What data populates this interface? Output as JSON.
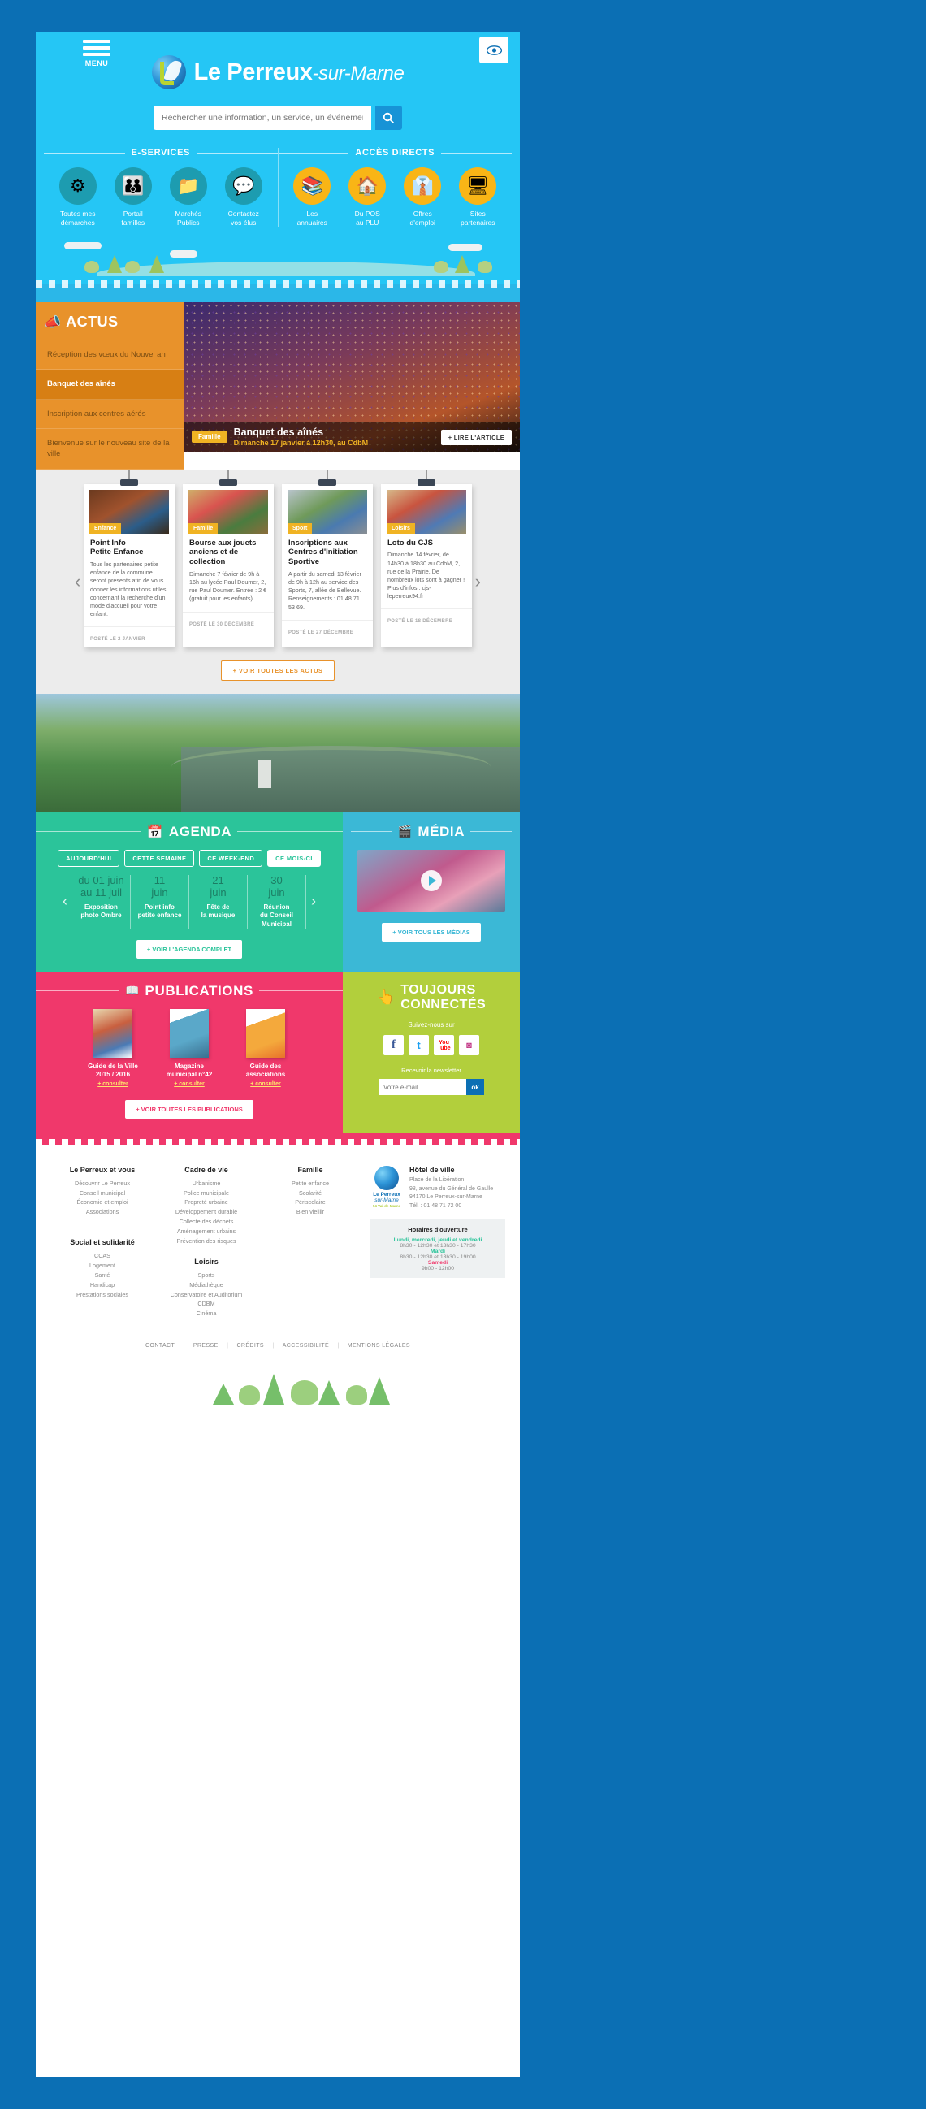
{
  "header": {
    "menu_label": "MENU",
    "accessibility_icon": "eye-icon",
    "brand_main": "Le Perreux",
    "brand_suffix": "-sur-Marne",
    "search_placeholder": "Rechercher une information, un service, un événement...",
    "search_value": "",
    "search_icon": "search-icon"
  },
  "eservices": {
    "title": "E-SERVICES",
    "items": [
      {
        "label_1": "Toutes mes",
        "label_2": "démarches",
        "icon": "gears-icon"
      },
      {
        "label_1": "Portail",
        "label_2": "familles",
        "icon": "family-icon"
      },
      {
        "label_1": "Marchés",
        "label_2": "Publics",
        "icon": "folder-icon"
      },
      {
        "label_1": "Contactez",
        "label_2": "vos élus",
        "icon": "speech-bubbles-icon"
      }
    ]
  },
  "acces_directs": {
    "title": "ACCÈS DIRECTS",
    "items": [
      {
        "label_1": "Les",
        "label_2": "annuaires",
        "icon": "binders-icon"
      },
      {
        "label_1": "Du POS",
        "label_2": "au PLU",
        "icon": "house-icon"
      },
      {
        "label_1": "Offres",
        "label_2": "d'emploi",
        "icon": "tie-icon"
      },
      {
        "label_1": "Sites",
        "label_2": "partenaires",
        "icon": "screen-icon"
      }
    ]
  },
  "actus": {
    "title": "ACTUS",
    "icon": "megaphone-icon",
    "items": [
      {
        "label": "Réception des vœux du Nouvel an",
        "active": false
      },
      {
        "label": "Banquet des aînés",
        "active": true
      },
      {
        "label": "Inscription aux centres aérés",
        "active": false
      },
      {
        "label": "Bienvenue sur le nouveau site de la ville",
        "active": false
      }
    ],
    "hero": {
      "tag": "Famille",
      "title": "Banquet des aînés",
      "subtitle": "Dimanche 17 janvier à 12h30, au CdbM",
      "read_button": "+ LIRE L'ARTICLE"
    }
  },
  "news": {
    "prev_icon": "chevron-left-icon",
    "next_icon": "chevron-right-icon",
    "see_all": "+ VOIR TOUTES LES ACTUS",
    "cards": [
      {
        "tag": "Enfance",
        "tag_color": "#f0b323",
        "title": "Point Info\nPetite Enfance",
        "excerpt": "Tous les partenaires petite enfance de la commune seront présents afin de vous donner les informations utiles concernant la recherche d'un mode d'accueil pour votre enfant.",
        "date": "POSTÉ LE 2 JANVIER"
      },
      {
        "tag": "Famille",
        "tag_color": "#f0b323",
        "title": "Bourse aux jouets anciens et de collection",
        "excerpt": "Dimanche 7 février de 9h à 16h au lycée Paul Doumer, 2, rue Paul Doumer. Entrée : 2 € (gratuit pour les enfants).",
        "date": "POSTÉ LE 30 DÉCEMBRE"
      },
      {
        "tag": "Sport",
        "tag_color": "#f0b323",
        "title": "Inscriptions aux Centres d'Initiation Sportive",
        "excerpt": "A partir du samedi 13 février de 9h à 12h au service des Sports, 7, allée de Bellevue. Renseignements : 01 48 71 53 69.",
        "date": "POSTÉ LE 27 DÉCEMBRE"
      },
      {
        "tag": "Loisirs",
        "tag_color": "#f0b323",
        "title": "Loto du CJS",
        "excerpt": "Dimanche 14 février, de 14h30 à 18h30 au CdbM, 2, rue de la Prairie. De nombreux lots sont à gagner ! Plus d'infos : cjs-leperreux94.fr",
        "date": "POSTÉ LE 18 DÉCEMBRE"
      }
    ]
  },
  "agenda": {
    "title": "AGENDA",
    "icon": "calendar-icon",
    "tabs": [
      {
        "label": "AUJOURD'HUI",
        "active": false
      },
      {
        "label": "CETTE SEMAINE",
        "active": false
      },
      {
        "label": "CE WEEK-END",
        "active": false
      },
      {
        "label": "CE MOIS-CI",
        "active": true
      }
    ],
    "prev_icon": "chevron-left-icon",
    "next_icon": "chevron-right-icon",
    "events": [
      {
        "date_1": "du 01 juin",
        "date_2": "au 11 juil",
        "name_1": "Exposition",
        "name_2": "photo Ombre"
      },
      {
        "date_1": "11",
        "date_2": "juin",
        "name_1": "Point info",
        "name_2": "petite enfance"
      },
      {
        "date_1": "21",
        "date_2": "juin",
        "name_1": "Fête de",
        "name_2": "la musique"
      },
      {
        "date_1": "30",
        "date_2": "juin",
        "name_1": "Réunion",
        "name_2": "du Conseil",
        "name_3": "Municipal"
      }
    ],
    "button": "+ VOIR L'AGENDA COMPLET"
  },
  "media": {
    "title": "MÉDIA",
    "icon": "video-icon",
    "play_icon": "play-icon",
    "button": "+ VOIR TOUS LES MÉDIAS"
  },
  "publications": {
    "title": "PUBLICATIONS",
    "icon": "book-icon",
    "items": [
      {
        "title_1": "Guide de la Ville",
        "title_2": "2015 / 2016",
        "link": "+ consulter"
      },
      {
        "title_1": "Magazine",
        "title_2": "municipal n°42",
        "link": "+ consulter"
      },
      {
        "title_1": "Guide des",
        "title_2": "associations",
        "link": "+ consulter"
      }
    ],
    "button": "+ VOIR TOUTES LES PUBLICATIONS"
  },
  "social": {
    "title_1": "TOUJOURS",
    "title_2": "CONNECTÉS",
    "icon": "hand-pointer-icon",
    "follow_label": "Suivez-nous sur",
    "networks": [
      {
        "name": "facebook-icon",
        "glyph": "f"
      },
      {
        "name": "twitter-icon",
        "glyph": "t"
      },
      {
        "name": "youtube-icon",
        "glyph": "You"
      },
      {
        "name": "instagram-icon",
        "glyph": "in"
      }
    ],
    "newsletter_label": "Recevoir la newsletter",
    "newsletter_placeholder": "Votre é-mail",
    "newsletter_value": "",
    "newsletter_button": "ok"
  },
  "footer": {
    "columns": [
      {
        "title": "Le Perreux et vous",
        "links": [
          "Découvrir Le Perreux",
          "Conseil municipal",
          "Économie et emploi",
          "Associations"
        ]
      },
      {
        "title": "Cadre de vie",
        "links": [
          "Urbanisme",
          "Police municipale",
          "Propreté urbaine",
          "Développement durable",
          "Collecte des déchets",
          "Aménagement urbains",
          "Prévention des risques"
        ]
      },
      {
        "title": "Famille",
        "links": [
          "Petite enfance",
          "Scolarité",
          "Périscolaire",
          "Bien vieillir"
        ]
      },
      {
        "title": "Social et solidarité",
        "links": [
          "CCAS",
          "Logement",
          "Santé",
          "Handicap",
          "Prestations sociales"
        ]
      },
      {
        "title": "Loisirs",
        "links": [
          "Sports",
          "Médiathèque",
          "Conservatoire et Auditorium",
          "CDBM",
          "Cinéma"
        ]
      }
    ],
    "hotel": {
      "logo_name": "Le Perreux",
      "logo_sub": "sur-Marne",
      "logo_tiny": "94 Val-de-Marne",
      "title": "Hôtel de ville",
      "lines": [
        "Place de la Libération,",
        "98, avenue du Général de Gaulle",
        "94170 Le Perreux-sur-Marne",
        "Tél. : 01 48 71 72 00"
      ]
    },
    "hours": {
      "title": "Horaires d'ouverture",
      "rows": [
        {
          "days": "Lundi, mercredi, jeudi et vendredi",
          "time": "8h30 - 12h30 et 13h30 - 17h30",
          "color": "teal"
        },
        {
          "days": "Mardi",
          "time": "8h30 - 12h30 et 13h30 - 19h00",
          "color": "teal"
        },
        {
          "days": "Samedi",
          "time": "9h00 - 12h00",
          "color": "pink"
        }
      ]
    },
    "bottom_links": [
      "CONTACT",
      "PRESSE",
      "CRÉDITS",
      "ACCESSIBILITÉ",
      "MENTIONS LÉGALES"
    ]
  },
  "colors": {
    "sky": "#25c6f5",
    "orange": "#e8922b",
    "green": "#2bc49a",
    "blue": "#3bb8d6",
    "pink": "#f0386b",
    "lime": "#b2cf3c",
    "frame": "#0b6fb4"
  }
}
